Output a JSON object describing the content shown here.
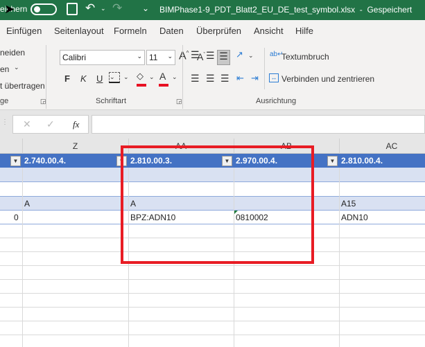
{
  "titlebar": {
    "autosave_label": "eichern",
    "file_title": "BIMPhase1-9_PDT_Blatt2_EU_DE_test_symbol.xlsx  -  Gespeichert"
  },
  "tabs": [
    "Einfügen",
    "Seitenlayout",
    "Formeln",
    "Daten",
    "Überprüfen",
    "Ansicht",
    "Hilfe"
  ],
  "ribbon": {
    "clipboard": {
      "cut": "neiden",
      "copy": "en",
      "format_painter": "t übertragen",
      "group": "ge"
    },
    "font": {
      "name": "Calibri",
      "size": "11",
      "bold": "F",
      "italic": "K",
      "underline": "U",
      "group": "Schriftart",
      "font_color": "#e81123",
      "fill_color": "#e81123"
    },
    "alignment": {
      "wrap": "Textumbruch",
      "merge": "Verbinden und zentrieren",
      "group": "Ausrichtung"
    }
  },
  "formula_bar": {
    "fx": "fx",
    "value": ""
  },
  "columns": [
    "Z",
    "AA",
    "AB",
    "AC"
  ],
  "filter_row": [
    "2.740.00.4.",
    "2.810.00.3.",
    "2.970.00.4.",
    "2.810.00.4."
  ],
  "rows": [
    {
      "c0": "",
      "c1": "",
      "c2": "",
      "c3": ""
    },
    {
      "c0": "",
      "c1": "",
      "c2": "",
      "c3": ""
    },
    {
      "c_left": "",
      "c0": "A",
      "c1": "A",
      "c2": "",
      "c3": "A15"
    },
    {
      "c_left": "0",
      "c0": "",
      "c1": "BPZ:ADN10",
      "c2": "0810002",
      "c3": "ADN10"
    }
  ],
  "colors": {
    "title": "#217346",
    "header_blue": "#4472c4",
    "band": "#d9e1f2",
    "highlight": "#e81c24"
  }
}
